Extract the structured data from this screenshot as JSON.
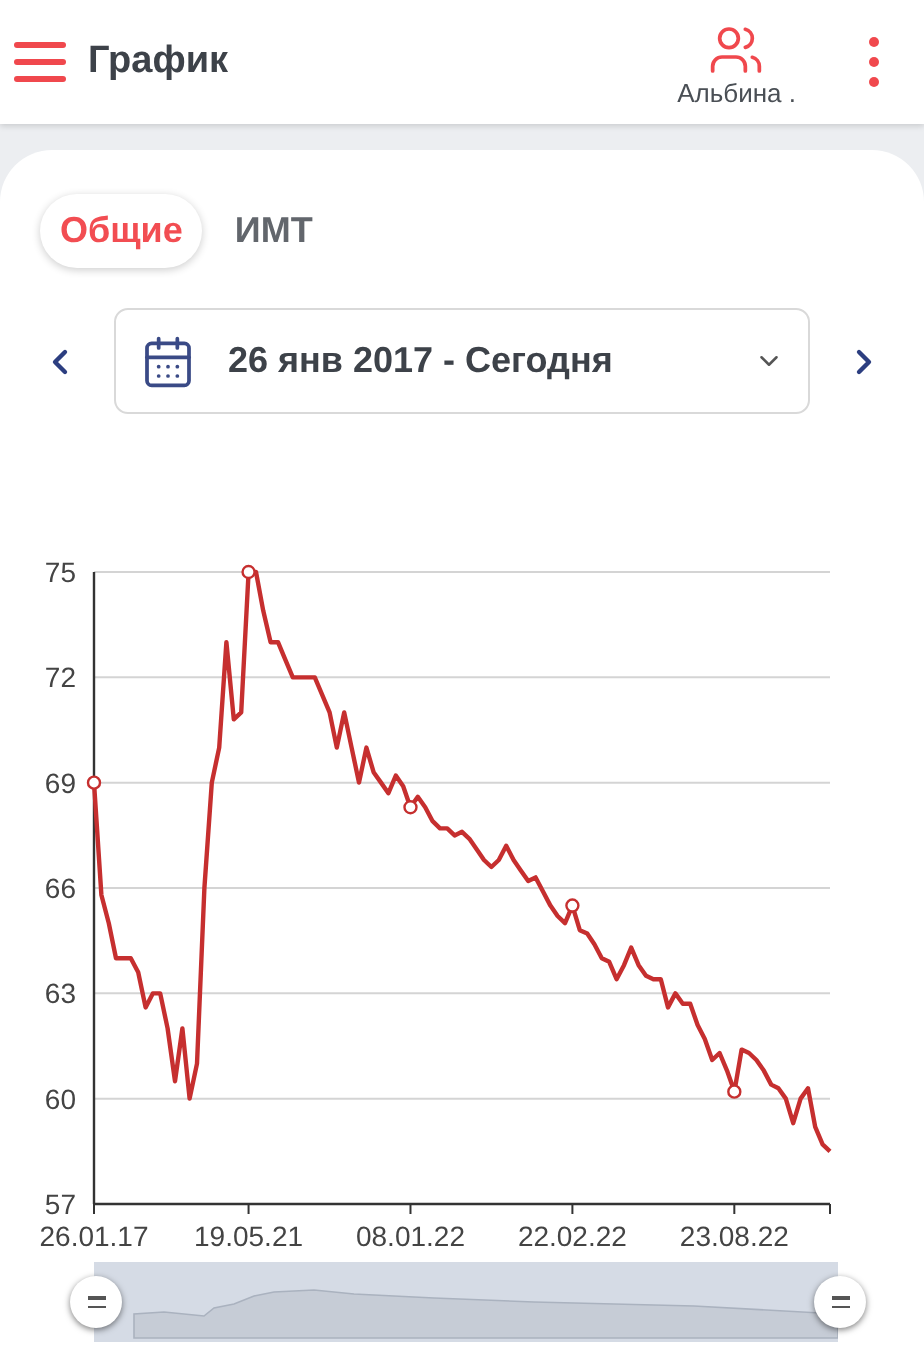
{
  "header": {
    "title": "График",
    "user_name": "Альбина ."
  },
  "tabs": [
    {
      "label": "Общие",
      "selected": true
    },
    {
      "label": "ИМТ",
      "selected": false
    }
  ],
  "date_range": {
    "value": "26 янв 2017 - Сегодня"
  },
  "chart_data": {
    "type": "line",
    "grid": true,
    "ylim": [
      57,
      75
    ],
    "yticks": [
      57,
      60,
      63,
      66,
      69,
      72,
      75
    ],
    "categories": [
      "26.01.17",
      null,
      null,
      null,
      null,
      null,
      null,
      null,
      null,
      null,
      null,
      null,
      null,
      null,
      null,
      null,
      null,
      null,
      null,
      null,
      null,
      "19.05.21",
      null,
      null,
      null,
      null,
      null,
      null,
      null,
      null,
      null,
      null,
      null,
      null,
      null,
      null,
      null,
      null,
      null,
      null,
      null,
      null,
      null,
      "08.01.22",
      null,
      null,
      null,
      null,
      null,
      null,
      null,
      null,
      null,
      null,
      null,
      null,
      null,
      null,
      null,
      null,
      null,
      null,
      null,
      null,
      null,
      "22.02.22",
      null,
      null,
      null,
      null,
      null,
      null,
      null,
      null,
      null,
      null,
      null,
      null,
      null,
      null,
      null,
      null,
      null,
      null,
      null,
      null,
      null,
      "23.08.22",
      null,
      null,
      null,
      null,
      null,
      null,
      null,
      null,
      null,
      null,
      null,
      null,
      null
    ],
    "series": [
      {
        "color": "#c62f2f",
        "values": [
          69,
          65.8,
          65,
          64,
          64,
          64,
          63.6,
          62.6,
          63,
          63,
          62,
          60.5,
          62,
          60,
          61,
          66,
          69,
          70,
          73,
          70.8,
          71,
          75,
          75,
          73.9,
          73,
          73,
          72.5,
          72,
          72,
          72,
          72,
          71.5,
          71,
          70,
          71,
          70,
          69,
          70,
          69.3,
          69,
          68.7,
          69.2,
          68.9,
          68.3,
          68.6,
          68.3,
          67.9,
          67.7,
          67.7,
          67.5,
          67.6,
          67.4,
          67.1,
          66.8,
          66.6,
          66.8,
          67.2,
          66.8,
          66.5,
          66.2,
          66.3,
          65.9,
          65.5,
          65.2,
          65,
          65.5,
          64.8,
          64.7,
          64.4,
          64,
          63.9,
          63.4,
          63.8,
          64.3,
          63.8,
          63.5,
          63.4,
          63.4,
          62.6,
          63,
          62.7,
          62.7,
          62.1,
          61.7,
          61.1,
          61.3,
          60.8,
          60.2,
          61.4,
          61.3,
          61.1,
          60.8,
          60.4,
          60.3,
          60,
          59.3,
          60,
          60.3,
          59.2,
          58.7,
          58.5
        ]
      }
    ]
  }
}
